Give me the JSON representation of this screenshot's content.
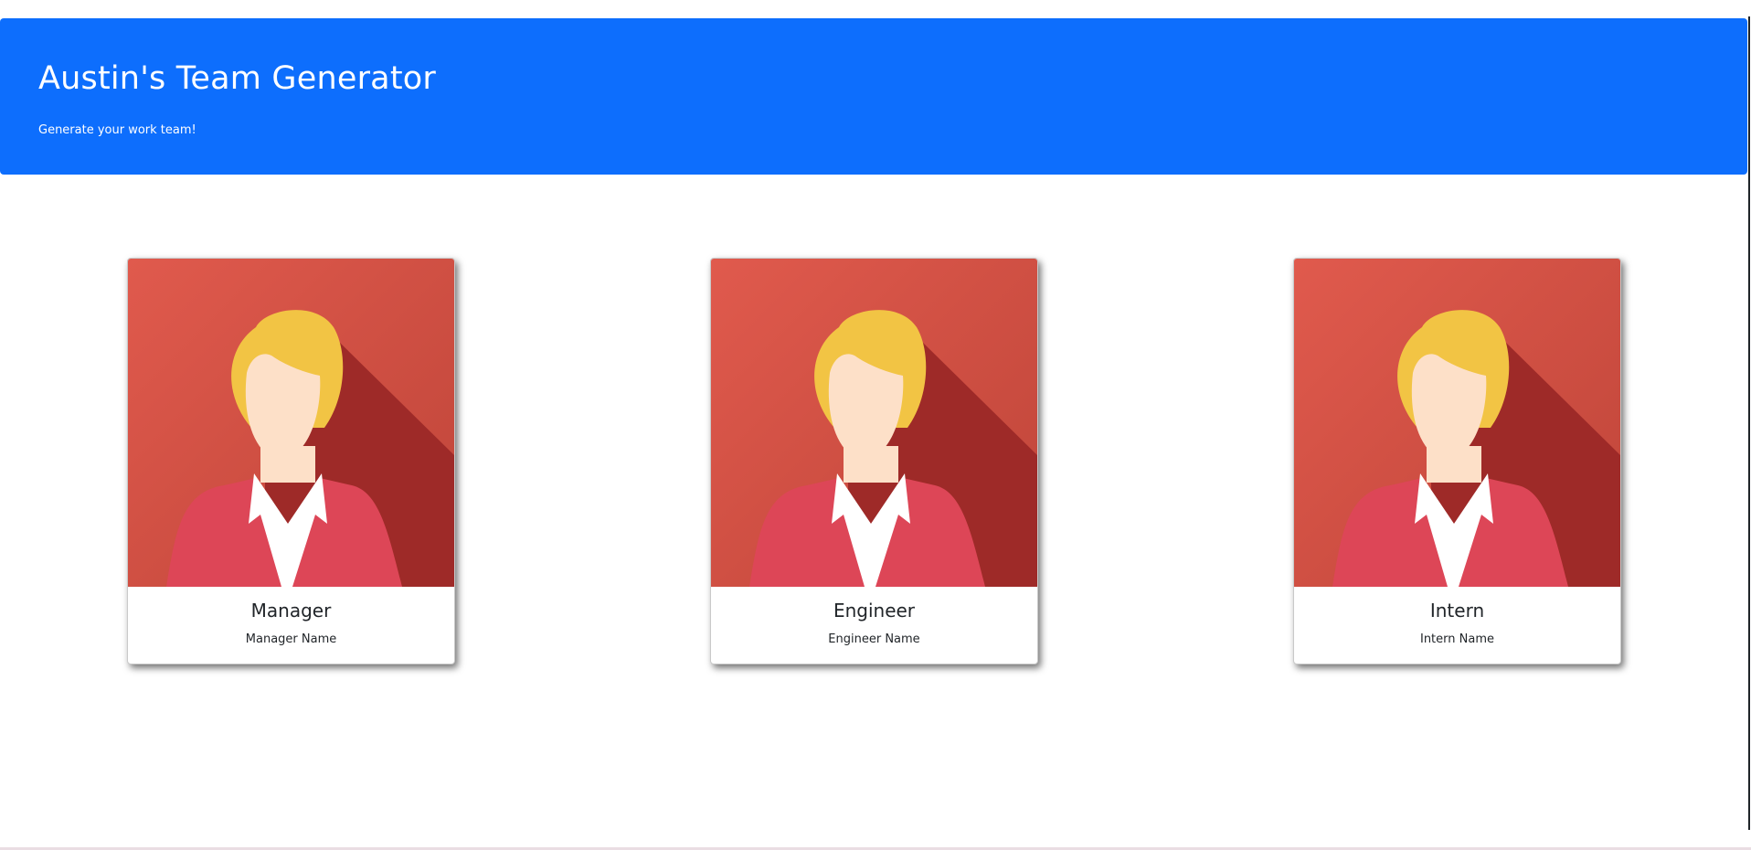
{
  "header": {
    "title": "Austin's Team Generator",
    "subtitle": "Generate your work team!"
  },
  "colors": {
    "header_bg": "#0d6efd",
    "card_bg_light": "#e05a4d",
    "card_bg_dark": "#c0453b",
    "card_shadow": "#9e2a28",
    "hair": "#f2c444",
    "skin": "#fde0c8",
    "jacket": "#dd4657",
    "shirt": "#ffffff"
  },
  "cards": [
    {
      "role": "Manager",
      "name": "Manager Name",
      "image": "female-avatar-icon"
    },
    {
      "role": "Engineer",
      "name": "Engineer Name",
      "image": "female-avatar-icon"
    },
    {
      "role": "Intern",
      "name": "Intern Name",
      "image": "female-avatar-icon"
    }
  ]
}
